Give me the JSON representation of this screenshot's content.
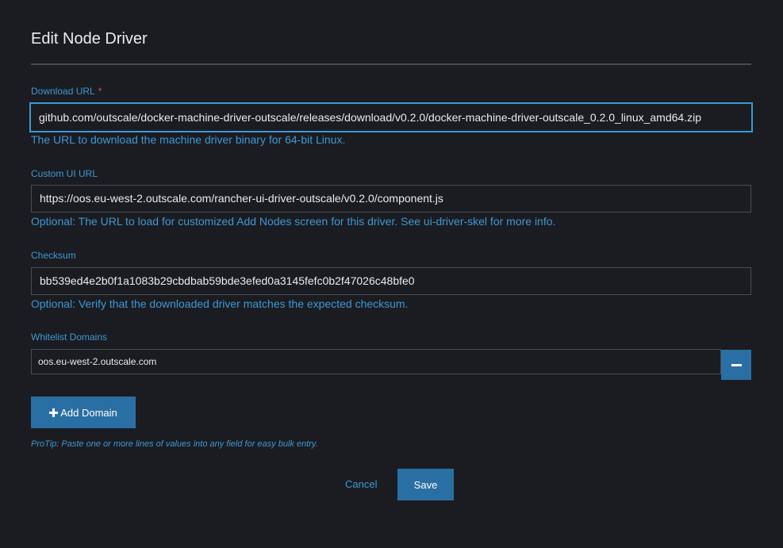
{
  "page": {
    "title": "Edit Node Driver"
  },
  "download_url": {
    "label": "Download URL",
    "required_mark": "*",
    "value": "github.com/outscale/docker-machine-driver-outscale/releases/download/v0.2.0/docker-machine-driver-outscale_0.2.0_linux_amd64.zip",
    "help": "The URL to download the machine driver binary for 64-bit Linux."
  },
  "custom_ui_url": {
    "label": "Custom UI URL",
    "value": "https://oos.eu-west-2.outscale.com/rancher-ui-driver-outscale/v0.2.0/component.js",
    "help": "Optional: The URL to load for customized Add Nodes screen for this driver. See ui-driver-skel for more info."
  },
  "checksum": {
    "label": "Checksum",
    "value": "bb539ed4e2b0f1a1083b29cbdbab59bde3efed0a3145fefc0b2f47026c48bfe0",
    "help": "Optional: Verify that the downloaded driver matches the expected checksum."
  },
  "whitelist": {
    "label": "Whitelist Domains",
    "domains": [
      "oos.eu-west-2.outscale.com"
    ],
    "add_label": "Add Domain"
  },
  "protip": "ProTip: Paste one or more lines of values into any field for easy bulk entry.",
  "actions": {
    "cancel": "Cancel",
    "save": "Save"
  },
  "colors": {
    "accent": "#3d98d3",
    "button": "#2a6fa3",
    "background": "#1b1c21",
    "required": "#e04b4b"
  },
  "icons": {
    "remove": "minus-icon",
    "add": "plus-icon"
  }
}
